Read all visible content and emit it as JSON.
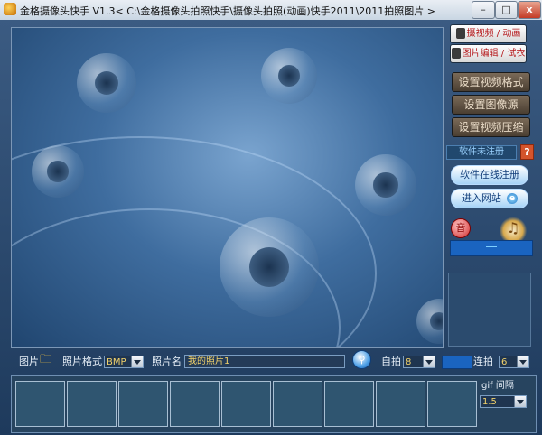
{
  "window": {
    "title": "金格摄像头快手 V1.3< C:\\金格摄像头拍照快手\\摄像头拍照(动画)快手2011\\2011拍照图片 >",
    "controls": {
      "minimize": "–",
      "maximize": "□",
      "close": "x"
    }
  },
  "sidebar": {
    "capture_video": "摄视频 / 动画",
    "edit_photo": "图片编辑 / 试衣",
    "set_video_format": "设置视频格式",
    "set_image_source": "设置图像源",
    "set_video_compress": "设置视频压缩",
    "register_status": "软件未注册",
    "help": "?",
    "online_activate": "软件在线注册",
    "enter_website": "进入网站",
    "ie_glyph": "e",
    "record_glyph": "音",
    "music_glyph": "♫",
    "status_value": "——"
  },
  "toolbar": {
    "picture_label": "图片",
    "format_label": "照片格式",
    "format_value": "BMP",
    "name_label": "照片名",
    "name_value": "我的照片1",
    "search_glyph": "⚲",
    "self_timer_label": "自拍",
    "self_timer_value": "8",
    "burst_label": "连拍",
    "burst_value": "6",
    "gif_interval_label": "gif 间隔",
    "gif_interval_value": "1.5"
  },
  "thumbnails": [
    "",
    "",
    "",
    "",
    "",
    "",
    "",
    "",
    ""
  ],
  "colors": {
    "accent": "#1a64c0",
    "warning": "#d4542b"
  }
}
